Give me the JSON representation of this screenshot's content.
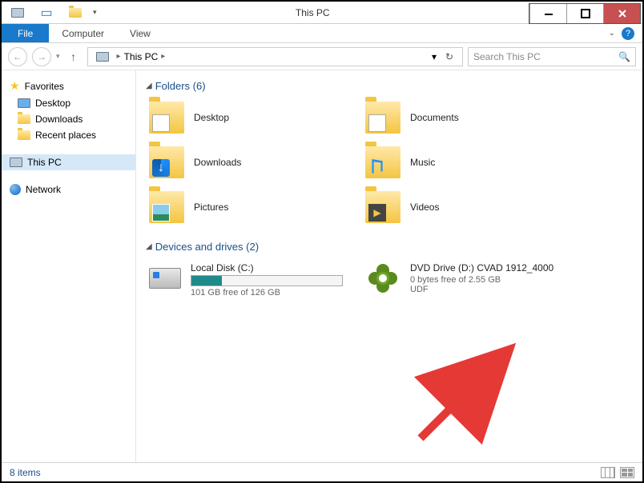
{
  "window": {
    "title": "This PC",
    "status": "8 items"
  },
  "tabs": {
    "file": "File",
    "computer": "Computer",
    "view": "View"
  },
  "breadcrumb": {
    "root": "This PC",
    "dropdown_glyph": "▸"
  },
  "search": {
    "placeholder": "Search This PC"
  },
  "sidebar": {
    "favorites": {
      "label": "Favorites",
      "items": [
        "Desktop",
        "Downloads",
        "Recent places"
      ]
    },
    "this_pc": "This PC",
    "network": "Network"
  },
  "sections": {
    "folders": {
      "title": "Folders (6)",
      "items": [
        "Desktop",
        "Documents",
        "Downloads",
        "Music",
        "Pictures",
        "Videos"
      ]
    },
    "drives": {
      "title": "Devices and drives (2)",
      "local": {
        "name": "Local Disk (C:)",
        "free": "101 GB free of 126 GB",
        "used_pct": 20
      },
      "dvd": {
        "name": "DVD Drive (D:) CVAD 1912_4000",
        "free": "0 bytes free of 2.55 GB",
        "fs": "UDF"
      }
    }
  }
}
